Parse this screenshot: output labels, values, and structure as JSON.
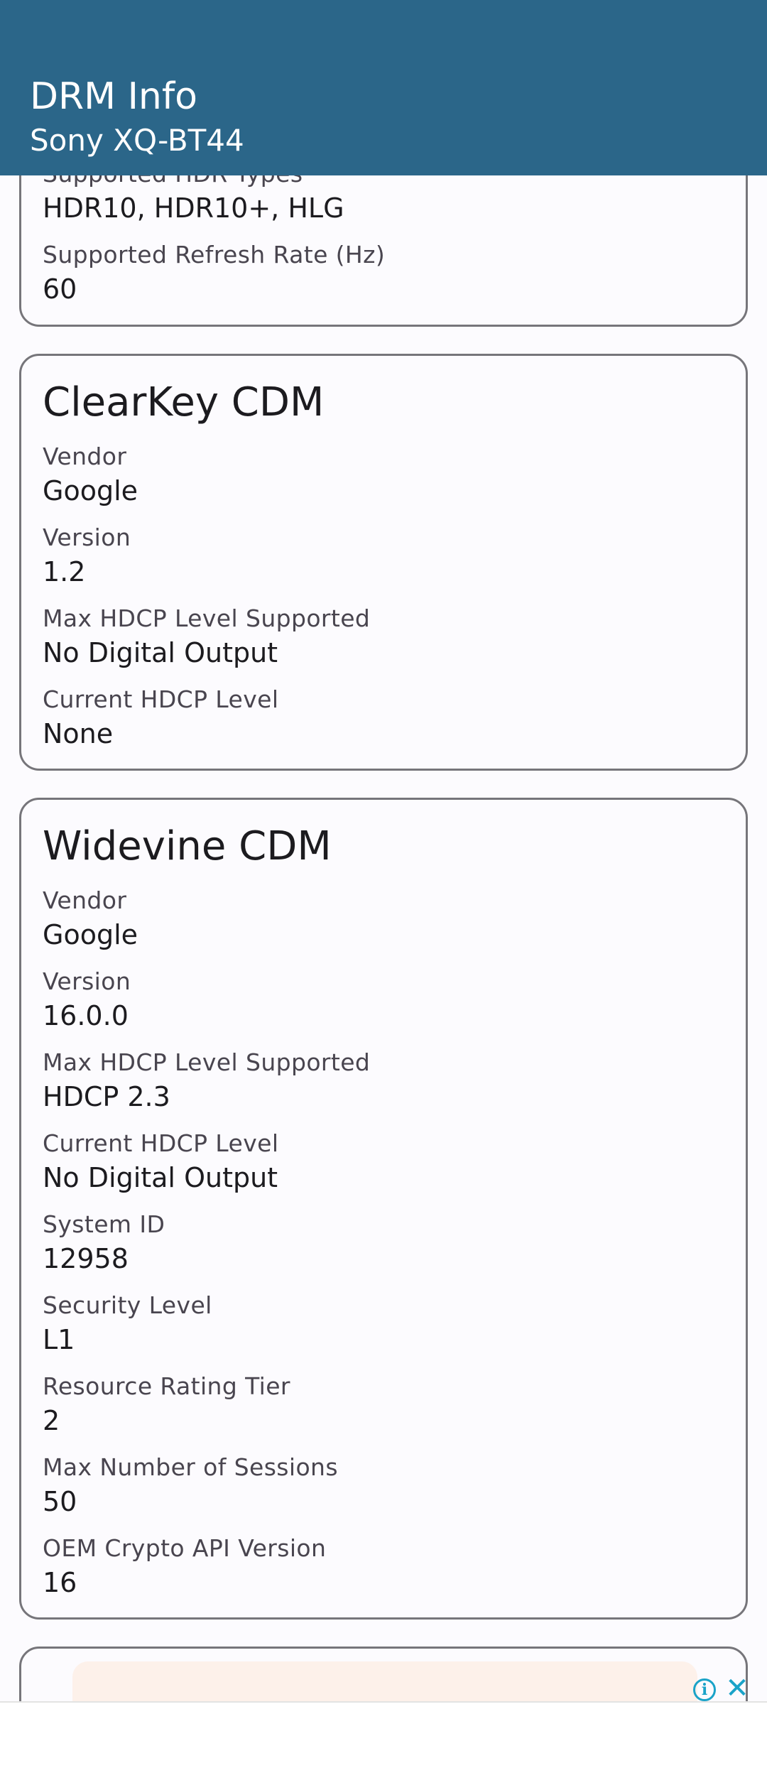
{
  "appbar": {
    "title": "DRM Info",
    "subtitle": "Sony XQ-BT44"
  },
  "display_card": {
    "fields": [
      {
        "label": "Supported HDR Types",
        "value": "HDR10, HDR10+, HLG"
      },
      {
        "label": "Supported Refresh Rate (Hz)",
        "value": "60"
      }
    ]
  },
  "clearkey_card": {
    "title": "ClearKey CDM",
    "fields": [
      {
        "label": "Vendor",
        "value": "Google"
      },
      {
        "label": "Version",
        "value": "1.2"
      },
      {
        "label": "Max HDCP Level Supported",
        "value": "No Digital Output"
      },
      {
        "label": "Current HDCP Level",
        "value": "None"
      }
    ]
  },
  "widevine_card": {
    "title": "Widevine CDM",
    "fields": [
      {
        "label": "Vendor",
        "value": "Google"
      },
      {
        "label": "Version",
        "value": "16.0.0"
      },
      {
        "label": "Max HDCP Level Supported",
        "value": "HDCP 2.3"
      },
      {
        "label": "Current HDCP Level",
        "value": "No Digital Output"
      },
      {
        "label": "System ID",
        "value": "12958"
      },
      {
        "label": "Security Level",
        "value": "L1"
      },
      {
        "label": "Resource Rating Tier",
        "value": "2"
      },
      {
        "label": "Max Number of Sessions",
        "value": "50"
      },
      {
        "label": "OEM Crypto API Version",
        "value": "16"
      }
    ]
  },
  "ad": {
    "info_icon": "info-icon",
    "close_icon": "close-icon"
  },
  "colors": {
    "appbar": "#2b6689",
    "card_border": "#76757a",
    "ad_accent": "#1aa3c8"
  }
}
